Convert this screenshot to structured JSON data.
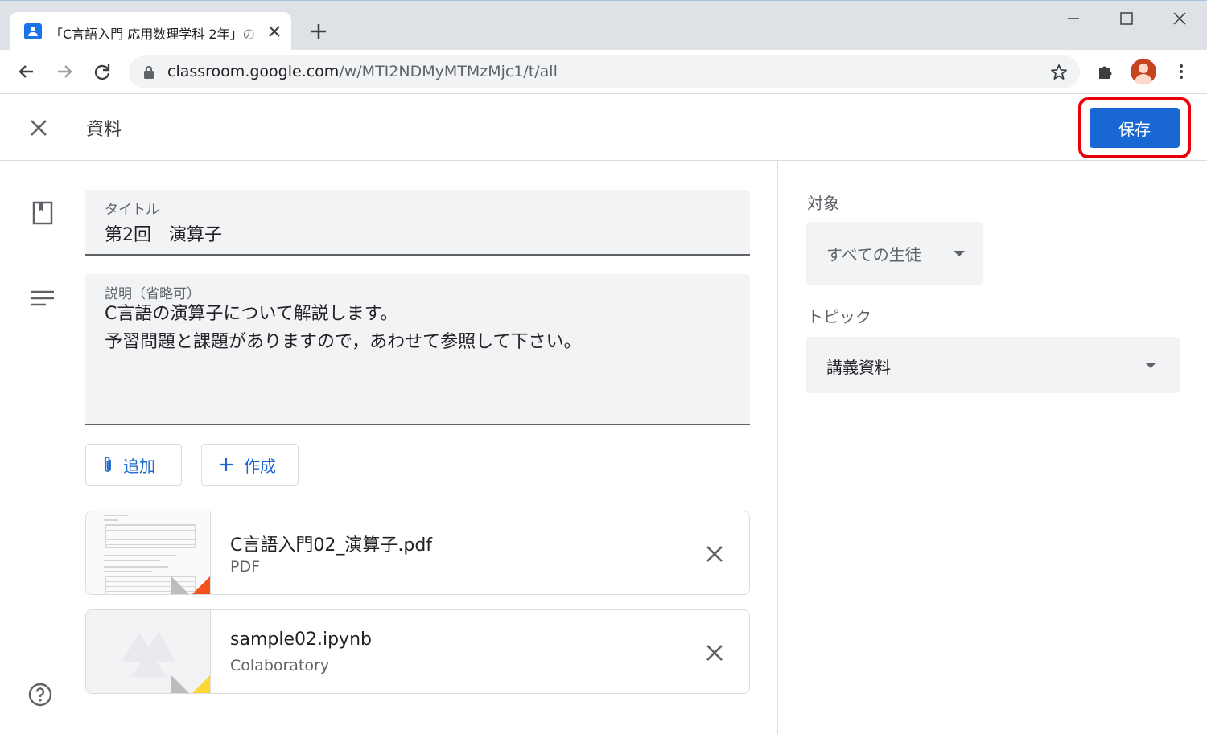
{
  "browser": {
    "tab_title": "「C言語入門 応用数理学科 2年」の",
    "url_host": "classroom.google.com",
    "url_path": "/w/MTI2NDMyMTMzMjc1/t/all"
  },
  "header": {
    "title": "資料",
    "save_label": "保存"
  },
  "form": {
    "title_label": "タイトル",
    "title_value": "第2回　演算子",
    "desc_label": "説明（省略可）",
    "desc_lines": [
      "C言語の演算子について解説します。",
      "予習問題と課題がありますので，あわせて参照して下さい。"
    ],
    "add_label": "追加",
    "create_label": "作成"
  },
  "attachments": [
    {
      "name": "C言語入門02_演算子.pdf",
      "type": "PDF",
      "corner_color": "#f4511e"
    },
    {
      "name": "sample02.ipynb",
      "type": "Colaboratory",
      "corner_color": "#fdd835"
    }
  ],
  "side": {
    "target_label": "対象",
    "target_value": "すべての生徒",
    "topic_label": "トピック",
    "topic_value": "講義資料"
  },
  "colors": {
    "primary": "#1967d2",
    "highlight": "#e8000b"
  }
}
